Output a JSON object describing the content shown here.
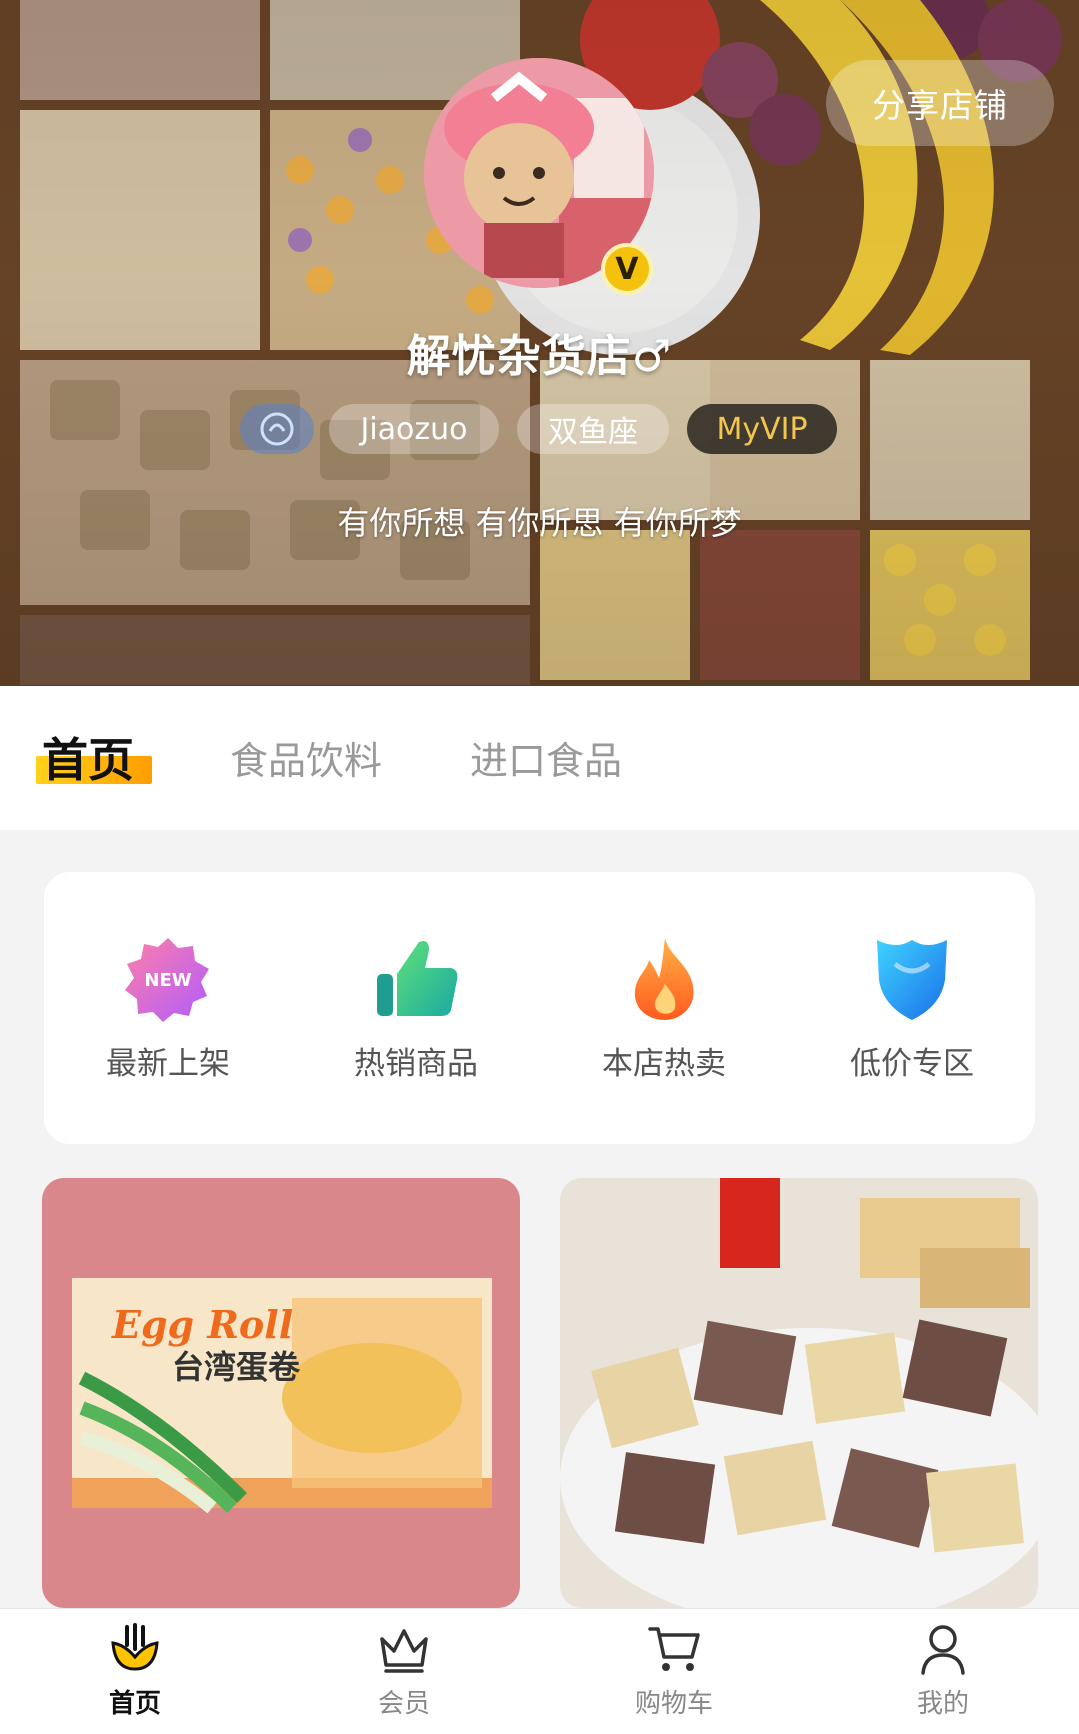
{
  "header": {
    "share_label": "分享店铺",
    "store_name": "解忧杂货店♂",
    "verified_badge": "V",
    "tags": [
      "Jiaozuo",
      "双鱼座",
      "MyVIP"
    ],
    "slogan": "有你所想 有你所思 有你所梦"
  },
  "tabs": [
    {
      "label": "首页",
      "active": true
    },
    {
      "label": "食品饮料",
      "active": false
    },
    {
      "label": "进口食品",
      "active": false
    }
  ],
  "categories": [
    {
      "label": "最新上架",
      "icon": "new-badge-icon",
      "badge_text": "NEW"
    },
    {
      "label": "热销商品",
      "icon": "thumbs-up-icon"
    },
    {
      "label": "本店热卖",
      "icon": "flame-icon"
    },
    {
      "label": "低价专区",
      "icon": "shield-icon"
    }
  ],
  "products": [
    {
      "brand_text": "Egg Roll",
      "name_text": "台湾蛋卷",
      "image": "egg-roll-box"
    },
    {
      "image": "wafer-bowl"
    }
  ],
  "bottom_nav": [
    {
      "label": "首页",
      "icon": "home-icon",
      "active": true
    },
    {
      "label": "会员",
      "icon": "crown-icon",
      "active": false
    },
    {
      "label": "购物车",
      "icon": "cart-icon",
      "active": false
    },
    {
      "label": "我的",
      "icon": "user-icon",
      "active": false
    }
  ],
  "colors": {
    "accent": "#ffc107",
    "tab_underline_start": "#ffd21a",
    "tab_underline_end": "#ff9d00",
    "vip_text": "#f4c64d"
  }
}
